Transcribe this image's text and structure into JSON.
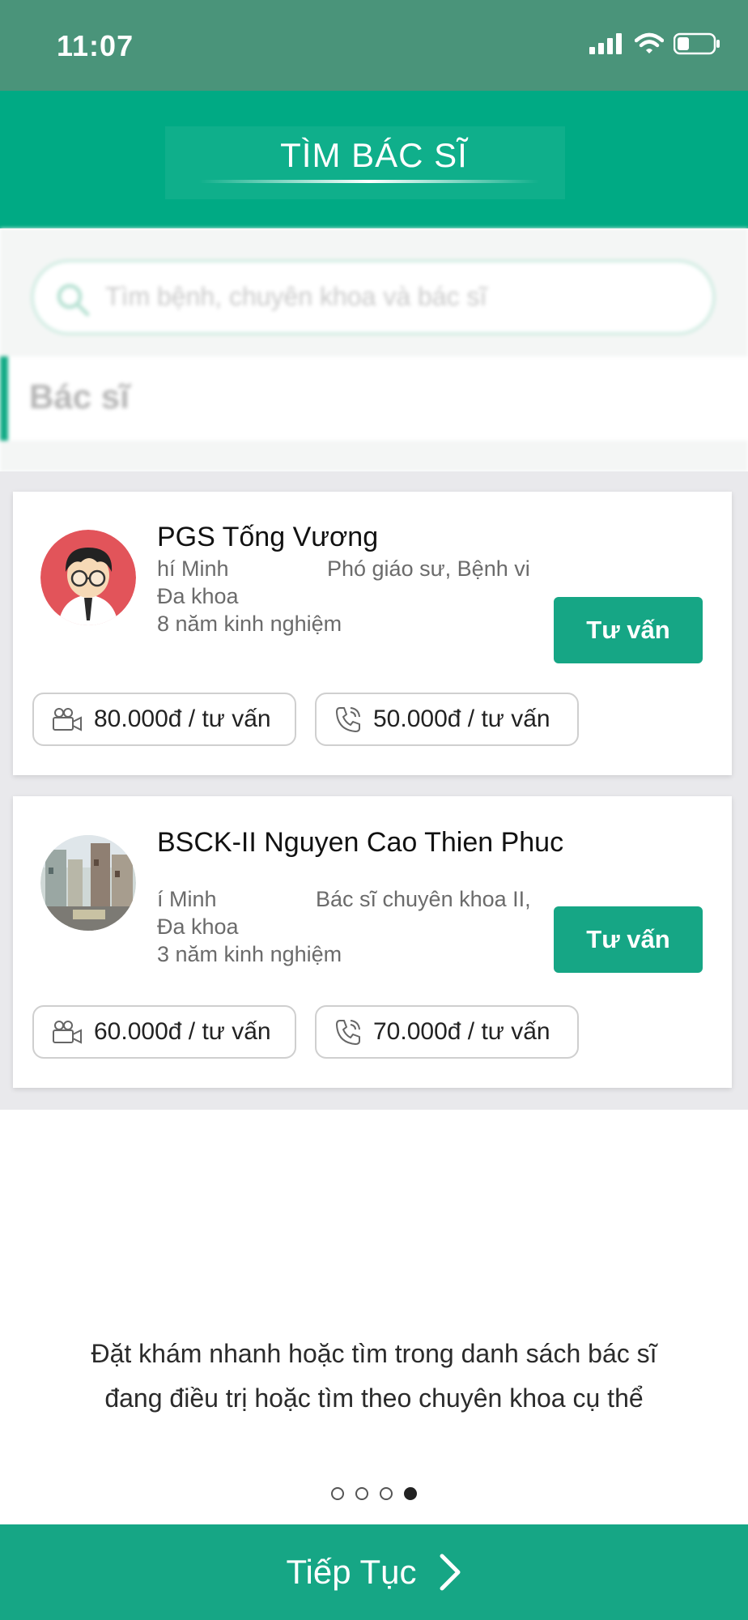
{
  "status_bar": {
    "time": "11:07"
  },
  "header": {
    "title": "TÌM BÁC SĨ"
  },
  "search": {
    "placeholder": "Tìm bệnh, chuyên khoa và bác sĩ"
  },
  "section": {
    "label": "Bác sĩ"
  },
  "doctors": [
    {
      "name": "PGS Tống Vương",
      "location": "hí Minh",
      "position": "Phó giáo sư, Bệnh vi",
      "specialty": "Đa khoa",
      "experience": "8 năm kinh nghiệm",
      "consult_label": "Tư vấn",
      "video_price": "80.000đ / tư vấn",
      "phone_price": "50.000đ / tư vấn"
    },
    {
      "name": "BSCK-II Nguyen Cao Thien Phuc",
      "location": "í Minh",
      "position": "Bác sĩ chuyên khoa II,",
      "specialty": "Đa khoa",
      "experience": "3 năm kinh nghiệm",
      "consult_label": "Tư vấn",
      "video_price": "60.000đ / tư vấn",
      "phone_price": "70.000đ / tư vấn"
    }
  ],
  "onboarding": {
    "description_line1": "Đặt khám nhanh hoặc tìm trong danh sách bác sĩ",
    "description_line2": "đang điều trị hoặc tìm theo chuyên khoa cụ thể",
    "page_count": 4,
    "current_page": 4
  },
  "footer": {
    "continue_label": "Tiếp Tục"
  },
  "colors": {
    "status_bar": "#4a947a",
    "header": "#00aa84",
    "accent": "#16a685"
  },
  "icons": {
    "video": "video-camera-icon",
    "phone": "phone-icon",
    "search": "search-icon",
    "next": "chevron-right-icon"
  }
}
